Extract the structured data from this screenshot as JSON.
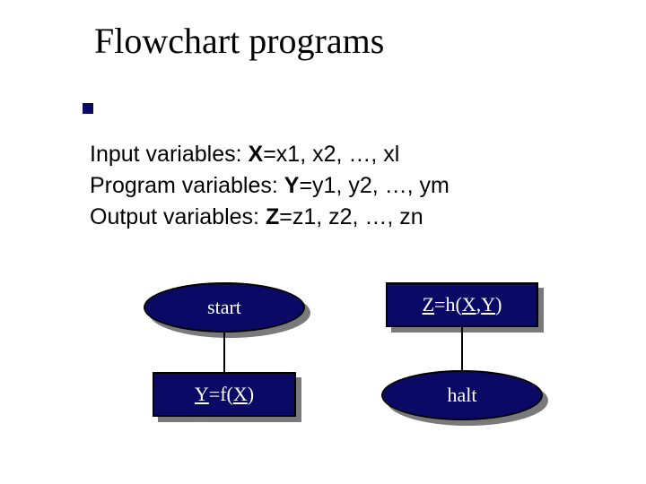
{
  "title": "Flowchart programs",
  "body": {
    "line1_pre": "Input variables: ",
    "line1_bold": "X",
    "line1_post": "=x1, x2, …, xl",
    "line2_pre": "Program variables: ",
    "line2_bold": "Y",
    "line2_post": "=y1, y2, …, ym",
    "line3_pre": "Output variables: ",
    "line3_bold": "Z",
    "line3_post": "=z1, z2, …, zn"
  },
  "nodes": {
    "start": "start",
    "assignY_pre": "Y",
    "assignY_mid": "=f(",
    "assignY_x": "X",
    "assignY_post": ")",
    "assignZ_pre": "Z",
    "assignZ_mid": "=h(",
    "assignZ_x": "X",
    "assignZ_comma": ",",
    "assignZ_y": "Y",
    "assignZ_post": ")",
    "halt": "halt"
  },
  "colors": {
    "node_fill": "#0a0a66",
    "shadow": "#7a7a7a"
  }
}
